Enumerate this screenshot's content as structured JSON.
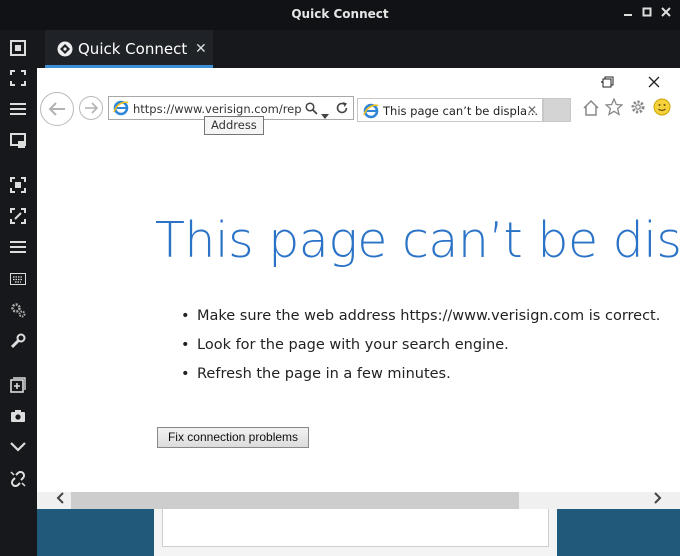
{
  "window": {
    "title": "Quick Connect"
  },
  "tab": {
    "label": "Quick Connect",
    "close": "✕"
  },
  "rail": {
    "icons": [
      "fit-screen-icon",
      "fullscreen-icon",
      "menu-icon",
      "window-icon",
      "fit-screen-2-icon",
      "resize-icon",
      "menu-2-icon",
      "keyboard-icon",
      "settings-icon",
      "wrench-icon",
      "add-window-icon",
      "camera-icon",
      "chevron-down-icon",
      "disconnect-link-icon"
    ]
  },
  "browser": {
    "address": "https://www.verisign.com/repo",
    "tooltip": "Address",
    "tab_title": "This page can’t be displa...",
    "tab_close": "✕"
  },
  "page": {
    "heading": "This page can’t be displa",
    "bullets": [
      "Make sure the web address https://www.verisign.com is correct.",
      "Look for the page with your search engine.",
      "Refresh the page in a few minutes."
    ],
    "fix_button": "Fix connection problems"
  },
  "colors": {
    "accent": "#3d8fd6",
    "heading": "#2a73c6",
    "remote_bg": "#1f5a7a"
  }
}
